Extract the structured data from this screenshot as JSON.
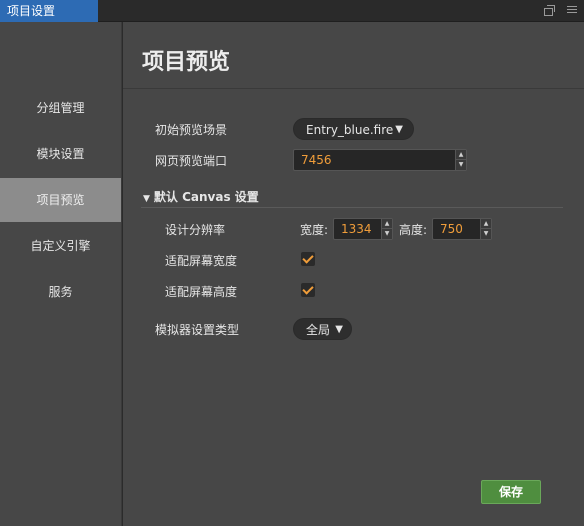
{
  "window": {
    "title": "项目设置",
    "controls": [
      "restore-icon",
      "menu-icon"
    ]
  },
  "sidebar": {
    "items": [
      {
        "label": "分组管理",
        "active": false
      },
      {
        "label": "模块设置",
        "active": false
      },
      {
        "label": "项目预览",
        "active": true
      },
      {
        "label": "自定义引擎",
        "active": false
      },
      {
        "label": "服务",
        "active": false
      }
    ]
  },
  "main": {
    "title": "项目预览",
    "initial_scene": {
      "label": "初始预览场景",
      "value": "Entry_blue.fire"
    },
    "port": {
      "label": "网页预览端口",
      "value": "7456"
    },
    "canvas_section": {
      "label": "默认 Canvas 设置",
      "resolution": {
        "label": "设计分辨率",
        "width_label": "宽度:",
        "width_value": "1334",
        "height_label": "高度:",
        "height_value": "750"
      },
      "fit_width": {
        "label": "适配屏幕宽度",
        "checked": true
      },
      "fit_height": {
        "label": "适配屏幕高度",
        "checked": true
      }
    },
    "simulator": {
      "label": "模拟器设置类型",
      "value": "全局"
    },
    "save_label": "保存"
  },
  "colors": {
    "accent": "#f09d3a",
    "title_tab": "#2d6bb4",
    "save_button": "#4f8e3f",
    "active_sidebar": "#8c8c8c"
  }
}
